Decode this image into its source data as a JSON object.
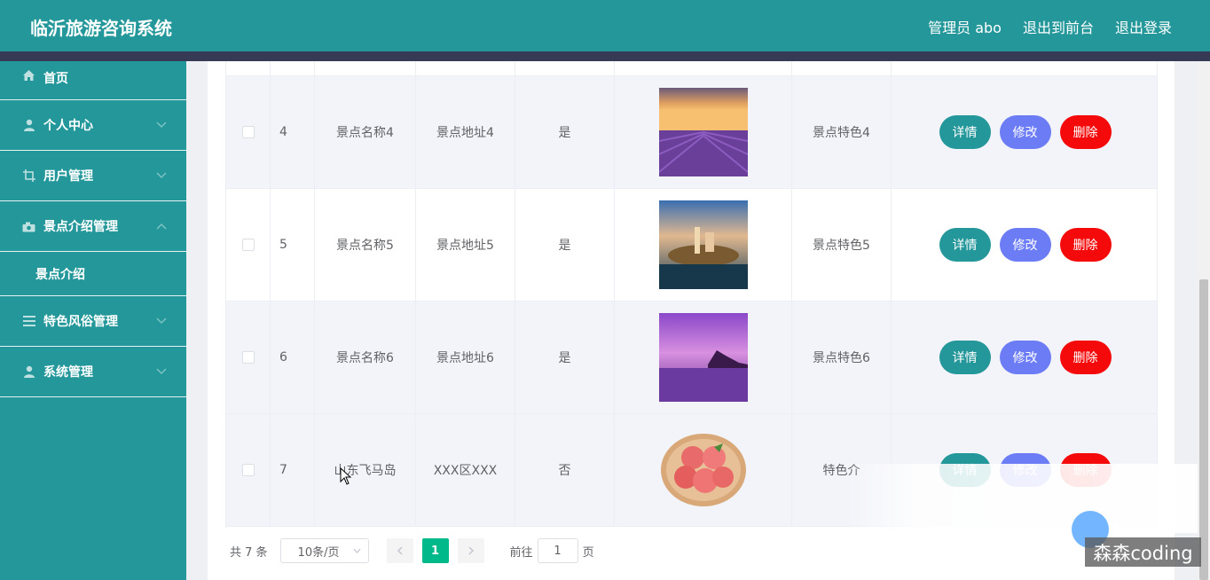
{
  "header": {
    "title": "临沂旅游咨询系统",
    "links": [
      "管理员 abo",
      "退出到前台",
      "退出登录"
    ]
  },
  "sidebar": {
    "items": [
      {
        "label": "首页",
        "icon": "home-icon"
      },
      {
        "label": "个人中心",
        "icon": "user-icon"
      },
      {
        "label": "用户管理",
        "icon": "crop-icon"
      },
      {
        "label": "景点介绍管理",
        "icon": "camera-icon"
      },
      {
        "label": "特色风俗管理",
        "icon": "list-icon"
      },
      {
        "label": "系统管理",
        "icon": "user-icon"
      }
    ],
    "submenu": {
      "label": "景点介绍"
    }
  },
  "table": {
    "rows": [
      {
        "idx": "4",
        "name": "景点名称4",
        "address": "景点地址4",
        "recommend": "是",
        "image": "lavender-field",
        "feature": "景点特色4"
      },
      {
        "idx": "5",
        "name": "景点名称5",
        "address": "景点地址5",
        "recommend": "是",
        "image": "lake-town",
        "feature": "景点特色5"
      },
      {
        "idx": "6",
        "name": "景点名称6",
        "address": "景点地址6",
        "recommend": "是",
        "image": "purple-sea",
        "feature": "景点特色6"
      },
      {
        "idx": "7",
        "name": "山东飞马岛",
        "address": "XXX区XXX",
        "recommend": "否",
        "image": "peaches",
        "feature": "特色介"
      }
    ],
    "actions": {
      "detail": "详情",
      "edit": "修改",
      "delete": "删除"
    }
  },
  "pagination": {
    "total": "共 7 条",
    "page_size": "10条/页",
    "current_page": "1",
    "goto_prefix": "前往",
    "goto_value": "1",
    "goto_suffix": "页"
  },
  "watermark": "森森coding",
  "colors": {
    "primary": "#23979a",
    "edit": "#6c7cf5",
    "delete": "#f40a0a",
    "page_active": "#00b98b",
    "strip": "#363a55"
  }
}
